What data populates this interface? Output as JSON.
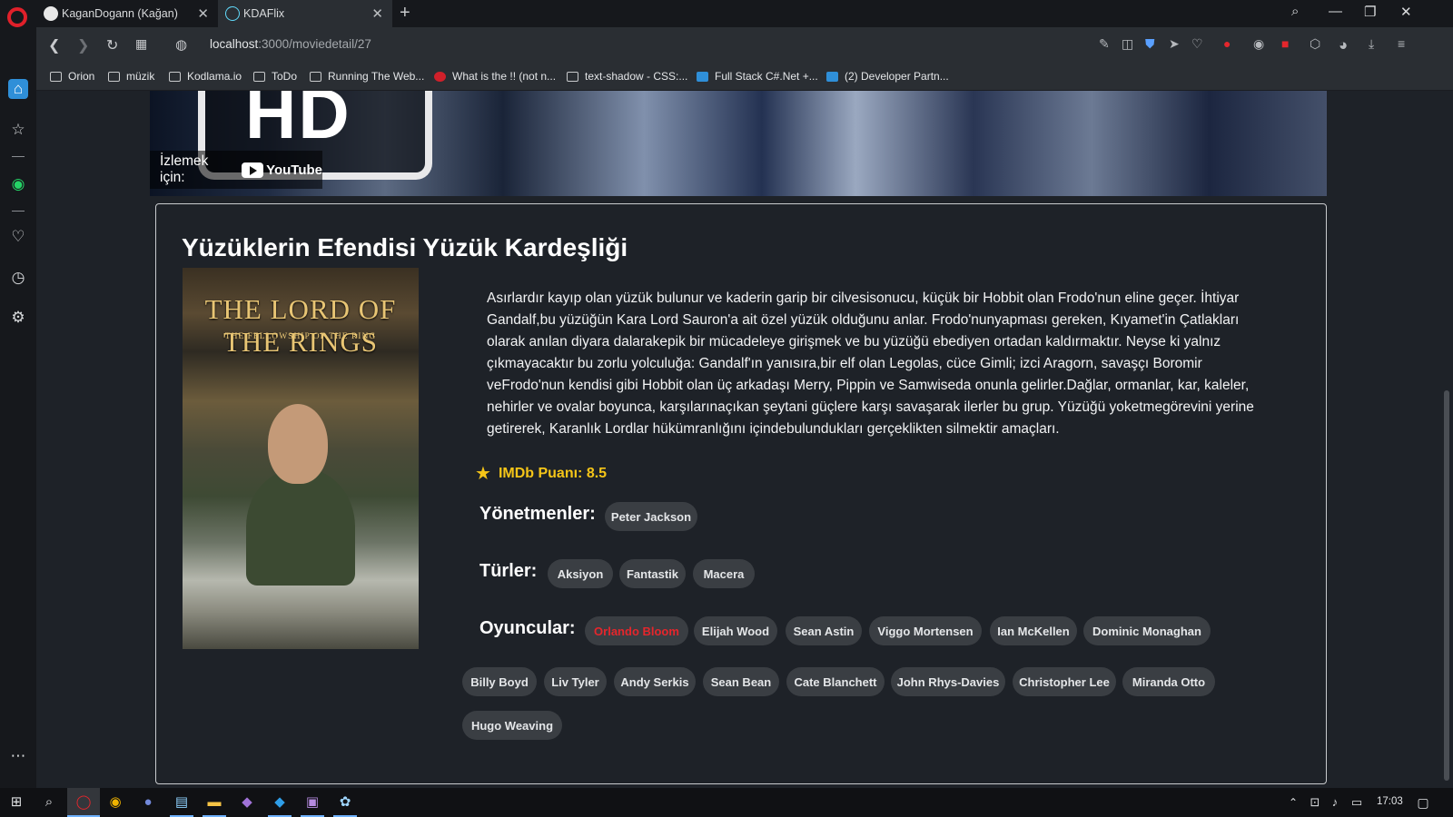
{
  "browser": {
    "tabs": [
      {
        "title": "KaganDogann (Kağan)"
      },
      {
        "title": "KDAFlix"
      }
    ],
    "url": {
      "host": "localhost",
      "path": ":3000/moviedetail/27"
    },
    "bookmarks": [
      {
        "label": "Orion"
      },
      {
        "label": "müzik"
      },
      {
        "label": "Kodlama.io"
      },
      {
        "label": "ToDo"
      },
      {
        "label": "Running The Web..."
      },
      {
        "label": "What is the !! (not n..."
      },
      {
        "label": "text-shadow - CSS:..."
      },
      {
        "label": "Full Stack C#.Net +..."
      },
      {
        "label": "(2) Developer Partn..."
      }
    ]
  },
  "trailer": {
    "badge_text": "HD",
    "watch_label": "İzlemek için:",
    "platform": "YouTube"
  },
  "movie": {
    "title": "Yüzüklerin Efendisi Yüzük Kardeşliği",
    "poster_title": "THE LORD OF THE RINGS",
    "poster_subtitle": "THE FELLOWSHIP OF THE RING",
    "description": "Asırlardır kayıp olan yüzük bulunur ve kaderin garip bir cilvesisonucu, küçük bir Hobbit olan Frodo'nun eline geçer. İhtiyar Gandalf,bu yüzüğün Kara Lord Sauron'a ait özel yüzük olduğunu anlar. Frodo'nunyapması gereken, Kıyamet'in Çatlakları olarak anılan diyara dalarakepik bir mücadeleye girişmek ve bu yüzüğü ebediyen ortadan kaldırmaktır. Neyse ki yalnız çıkmayacaktır bu zorlu yolculuğa: Gandalf'ın yanısıra,bir elf olan Legolas, cüce Gimli; izci Aragorn, savaşçı Boromir veFrodo'nun kendisi gibi Hobbit olan üç arkadaşı Merry, Pippin ve Samwiseda onunla gelirler.Dağlar, ormanlar, kar, kaleler, nehirler ve ovalar boyunca, karşılarınaçıkan şeytani güçlere karşı savaşarak ilerler bu grup. Yüzüğü yoketmegörevini yerine getirerek, Karanlık Lordlar hükümranlığını içindebulundukları gerçeklikten silmektir amaçları.",
    "imdb": "IMDb Puanı: 8.5",
    "directors_label": "Yönetmenler:",
    "directors": [
      "Peter Jackson"
    ],
    "genres_label": "Türler:",
    "genres": [
      "Aksiyon",
      "Fantastik",
      "Macera"
    ],
    "cast_label": "Oyuncular:",
    "cast": [
      "Orlando Bloom",
      "Elijah Wood",
      "Sean Astin",
      "Viggo Mortensen",
      "Ian McKellen",
      "Dominic Monaghan",
      "Billy Boyd",
      "Liv Tyler",
      "Andy Serkis",
      "Sean Bean",
      "Cate Blanchett",
      "John Rhys-Davies",
      "Christopher Lee",
      "Miranda Otto",
      "Hugo Weaving"
    ],
    "active_cast": "Orlando Bloom"
  },
  "taskbar": {
    "time": "17:03"
  },
  "colors": {
    "accent_red": "#e5262c",
    "imdb_yellow": "#f5c518",
    "page_bg": "#1e2228",
    "chip_bg": "#3a3e43"
  }
}
